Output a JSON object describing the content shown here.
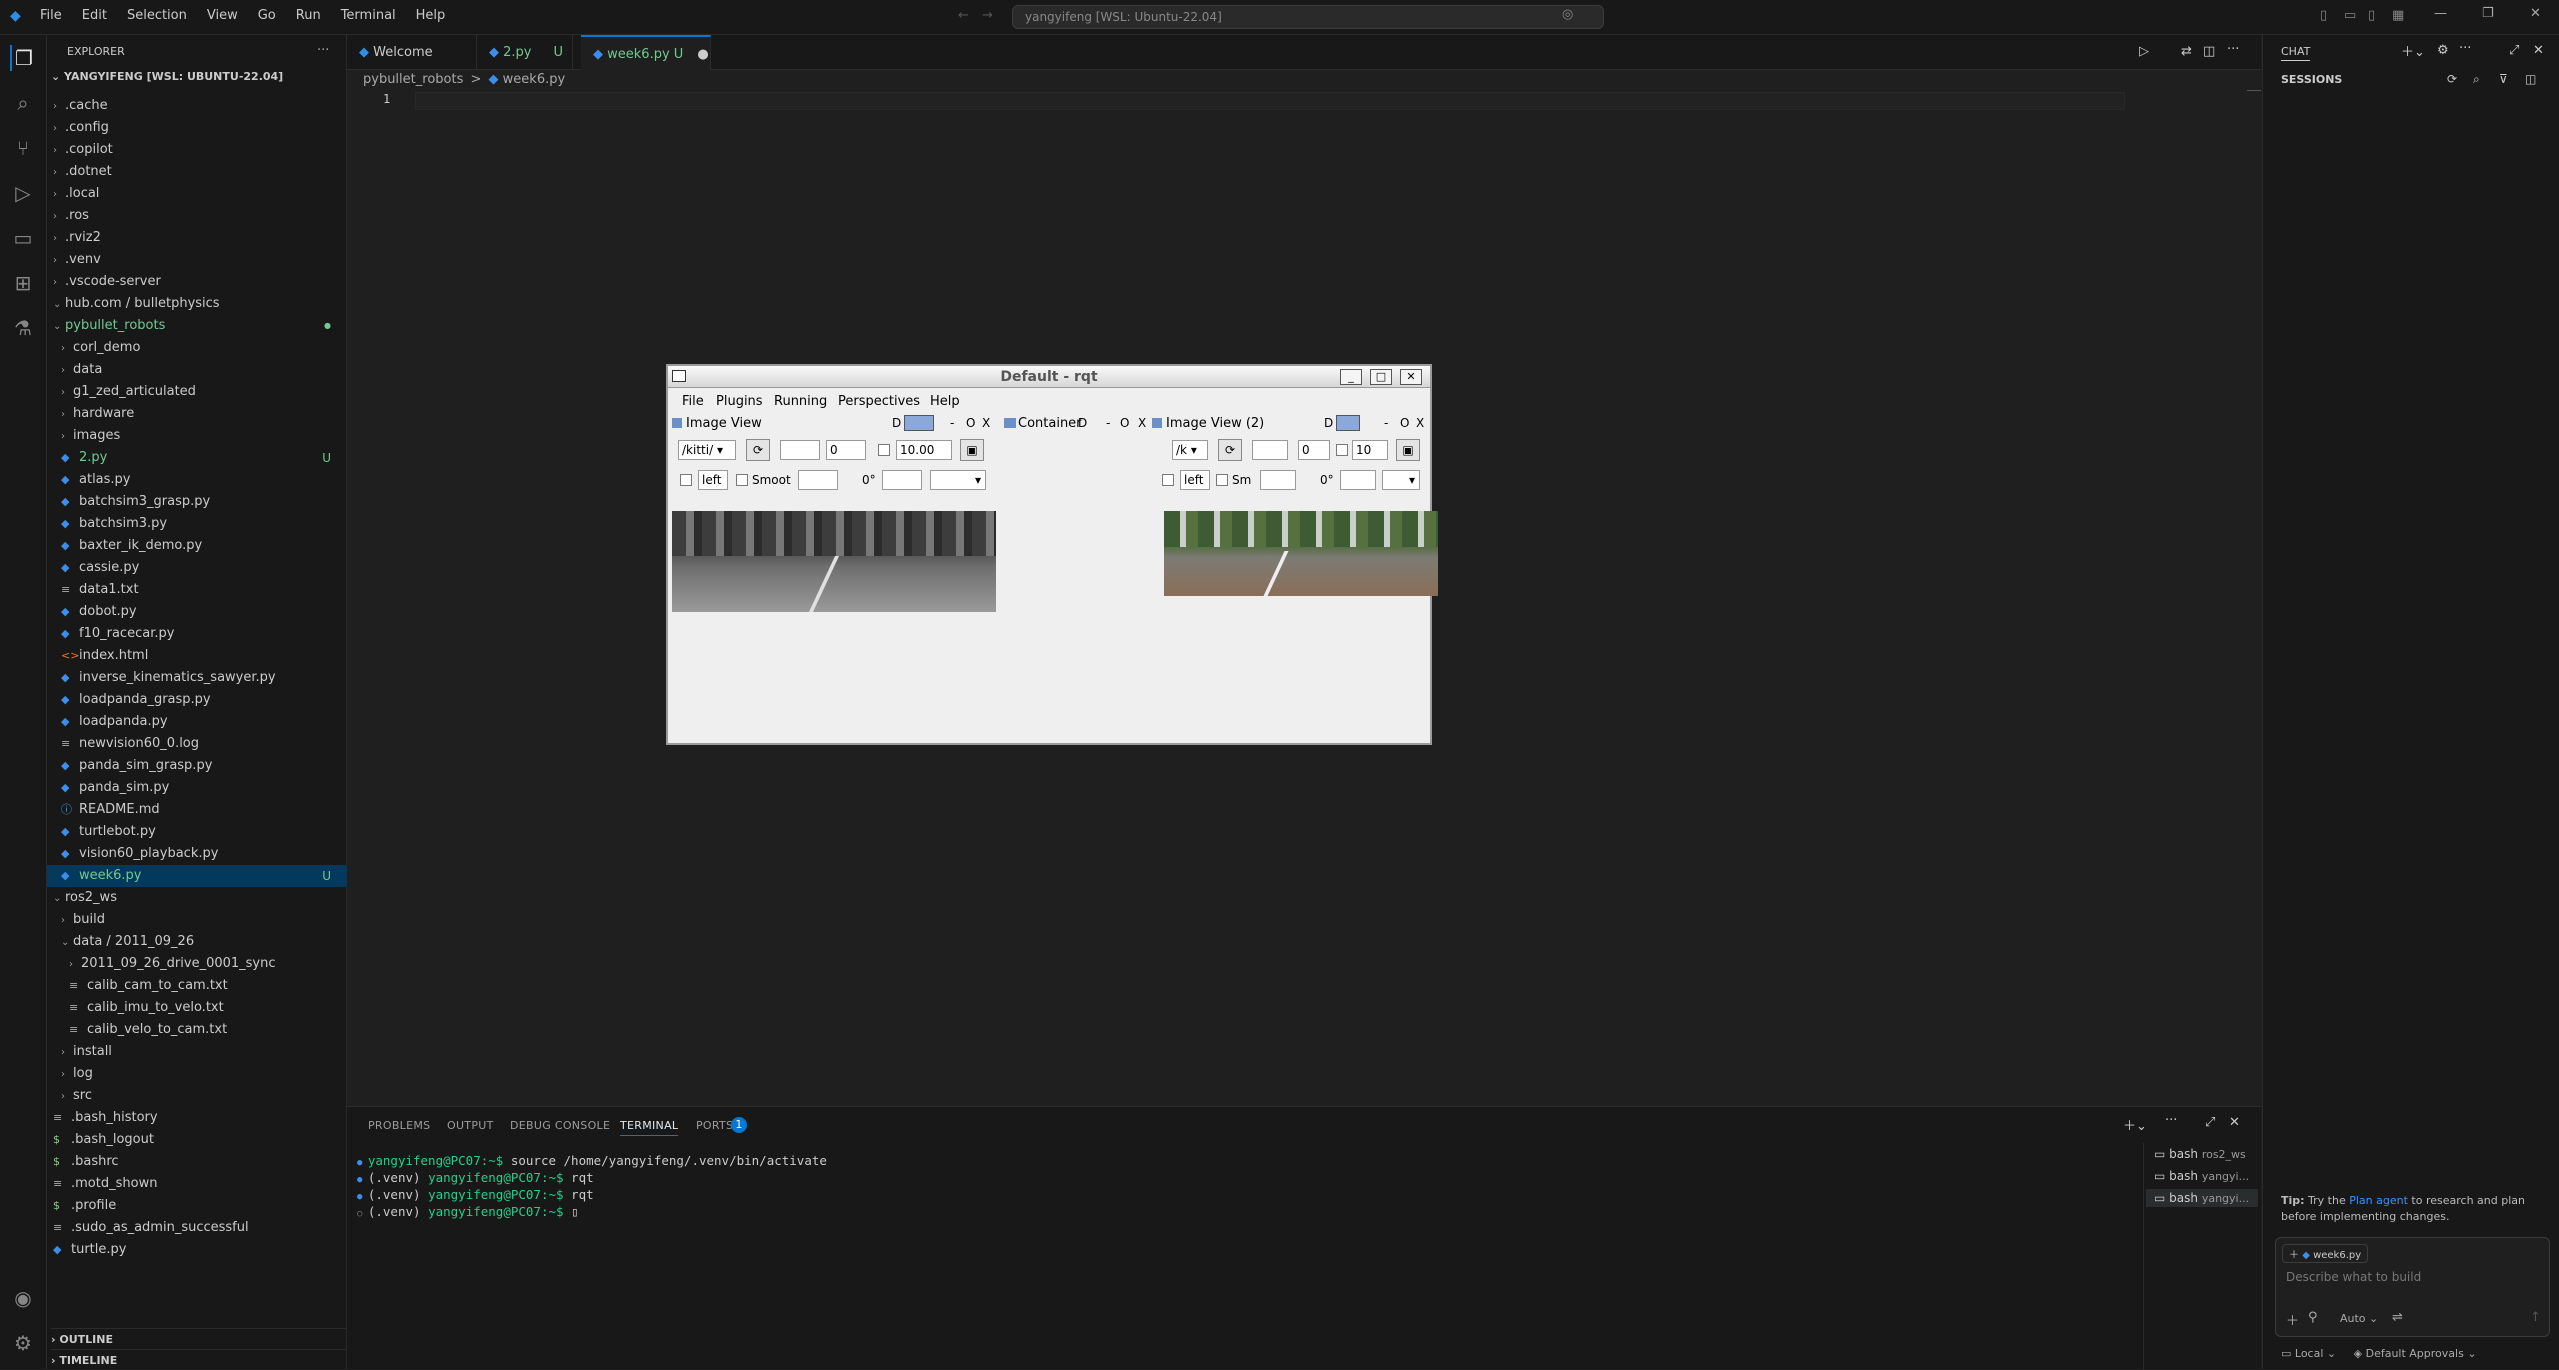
{
  "titlebar": {
    "menu": [
      "File",
      "Edit",
      "Selection",
      "View",
      "Go",
      "Run",
      "Terminal",
      "Help"
    ],
    "command_center": "yangyifeng [WSL: Ubuntu-22.04]"
  },
  "explorer": {
    "header": "EXPLORER",
    "root": "YANGYIFENG [WSL: UBUNTU-22.04]",
    "rows": [
      {
        "label": ".cache",
        "type": "folder",
        "depth": 1
      },
      {
        "label": ".config",
        "type": "folder",
        "depth": 1
      },
      {
        "label": ".copilot",
        "type": "folder",
        "depth": 1
      },
      {
        "label": ".dotnet",
        "type": "folder",
        "depth": 1
      },
      {
        "label": ".local",
        "type": "folder",
        "depth": 1
      },
      {
        "label": ".ros",
        "type": "folder",
        "depth": 1
      },
      {
        "label": ".rviz2",
        "type": "folder",
        "depth": 1
      },
      {
        "label": ".venv",
        "type": "folder",
        "depth": 1
      },
      {
        "label": ".vscode-server",
        "type": "folder",
        "depth": 1
      },
      {
        "label": "hub.com / bulletphysics",
        "type": "folder-open",
        "depth": 1
      },
      {
        "label": "pybullet_robots",
        "type": "folder-open",
        "depth": 1,
        "status": "dot"
      },
      {
        "label": "corl_demo",
        "type": "folder",
        "depth": 2
      },
      {
        "label": "data",
        "type": "folder",
        "depth": 2
      },
      {
        "label": "g1_zed_articulated",
        "type": "folder",
        "depth": 2
      },
      {
        "label": "hardware",
        "type": "folder",
        "depth": 2
      },
      {
        "label": "images",
        "type": "folder",
        "depth": 2
      },
      {
        "label": "2.py",
        "type": "py",
        "depth": 2,
        "status": "U"
      },
      {
        "label": "atlas.py",
        "type": "py",
        "depth": 2
      },
      {
        "label": "batchsim3_grasp.py",
        "type": "py",
        "depth": 2
      },
      {
        "label": "batchsim3.py",
        "type": "py",
        "depth": 2
      },
      {
        "label": "baxter_ik_demo.py",
        "type": "py",
        "depth": 2
      },
      {
        "label": "cassie.py",
        "type": "py",
        "depth": 2
      },
      {
        "label": "data1.txt",
        "type": "txt",
        "depth": 2
      },
      {
        "label": "dobot.py",
        "type": "py",
        "depth": 2
      },
      {
        "label": "f10_racecar.py",
        "type": "py",
        "depth": 2
      },
      {
        "label": "index.html",
        "type": "html",
        "depth": 2
      },
      {
        "label": "inverse_kinematics_sawyer.py",
        "type": "py",
        "depth": 2
      },
      {
        "label": "loadpanda_grasp.py",
        "type": "py",
        "depth": 2
      },
      {
        "label": "loadpanda.py",
        "type": "py",
        "depth": 2
      },
      {
        "label": "newvision60_0.log",
        "type": "txt",
        "depth": 2
      },
      {
        "label": "panda_sim_grasp.py",
        "type": "py",
        "depth": 2
      },
      {
        "label": "panda_sim.py",
        "type": "py",
        "depth": 2
      },
      {
        "label": "README.md",
        "type": "md",
        "depth": 2
      },
      {
        "label": "turtlebot.py",
        "type": "py",
        "depth": 2
      },
      {
        "label": "vision60_playback.py",
        "type": "py",
        "depth": 2
      },
      {
        "label": "week6.py",
        "type": "py",
        "depth": 2,
        "status": "U",
        "selected": true
      },
      {
        "label": "ros2_ws",
        "type": "folder-open",
        "depth": 1
      },
      {
        "label": "build",
        "type": "folder",
        "depth": 2
      },
      {
        "label": "data / 2011_09_26",
        "type": "folder-open",
        "depth": 2
      },
      {
        "label": "2011_09_26_drive_0001_sync",
        "type": "folder",
        "depth": 3
      },
      {
        "label": "calib_cam_to_cam.txt",
        "type": "txt",
        "depth": 3
      },
      {
        "label": "calib_imu_to_velo.txt",
        "type": "txt",
        "depth": 3
      },
      {
        "label": "calib_velo_to_cam.txt",
        "type": "txt",
        "depth": 3
      },
      {
        "label": "install",
        "type": "folder",
        "depth": 2
      },
      {
        "label": "log",
        "type": "folder",
        "depth": 2
      },
      {
        "label": "src",
        "type": "folder",
        "depth": 2
      },
      {
        "label": ".bash_history",
        "type": "txt",
        "depth": 1
      },
      {
        "label": ".bash_logout",
        "type": "sh",
        "depth": 1
      },
      {
        "label": ".bashrc",
        "type": "sh",
        "depth": 1
      },
      {
        "label": ".motd_shown",
        "type": "txt",
        "depth": 1
      },
      {
        "label": ".profile",
        "type": "sh",
        "depth": 1
      },
      {
        "label": ".sudo_as_admin_successful",
        "type": "txt",
        "depth": 1
      },
      {
        "label": "turtle.py",
        "type": "py",
        "depth": 1
      }
    ],
    "outline": "OUTLINE",
    "timeline": "TIMELINE"
  },
  "tabs": [
    {
      "label": "Welcome",
      "status": ""
    },
    {
      "label": "2.py",
      "status": "U"
    },
    {
      "label": "week6.py",
      "status": "U"
    }
  ],
  "breadcrumb": {
    "folder": "pybullet_robots",
    "file": "week6.py",
    "sep": ">"
  },
  "editor": {
    "line_number": "1"
  },
  "panel": {
    "tabs": [
      "PROBLEMS",
      "OUTPUT",
      "DEBUG CONSOLE",
      "TERMINAL",
      "PORTS"
    ],
    "ports_count": "1",
    "terminal": [
      {
        "venv": "",
        "prompt": "yangyifeng@PC07:~$",
        "cmd": " source /home/yangyifeng/.venv/bin/activate"
      },
      {
        "venv": "(.venv) ",
        "prompt": "yangyifeng@PC07:~$",
        "cmd": " rqt"
      },
      {
        "venv": "(.venv) ",
        "prompt": "yangyifeng@PC07:~$",
        "cmd": " rqt"
      },
      {
        "venv": "(.venv) ",
        "prompt": "yangyifeng@PC07:~$",
        "cmd": " "
      }
    ],
    "sessions": [
      {
        "name": "bash",
        "detail": "ros2_ws"
      },
      {
        "name": "bash",
        "detail": "yangyi..."
      },
      {
        "name": "bash",
        "detail": "yangyi..."
      }
    ]
  },
  "chat": {
    "header": "CHAT",
    "sessions": "SESSIONS",
    "tip_prefix": "Tip:",
    "tip_a": " Try the ",
    "tip_link": "Plan agent",
    "tip_b": " to research and plan before implementing changes.",
    "context_file": "week6.py",
    "input_placeholder": "Describe what to build",
    "mode": "Auto"
  },
  "statusbar": {
    "local": "Local",
    "approvals": "Default Approvals"
  },
  "rqt": {
    "title": "Default - rqt",
    "menu": [
      "File",
      "Plugins",
      "Running",
      "Perspectives",
      "Help"
    ],
    "panes": {
      "image_view": "Image View",
      "container": "Container",
      "image_view2": "Image View (2)"
    },
    "controls": {
      "topic1": "/kitti/",
      "topic2": "/k",
      "zero": "0",
      "rate1": "10.00",
      "rate2": "10",
      "left": "left",
      "smooth": "Smoot",
      "smooth2": "Sm",
      "deg": "0°",
      "d": "D",
      "dash": "-",
      "o": "O",
      "x": "X"
    }
  }
}
